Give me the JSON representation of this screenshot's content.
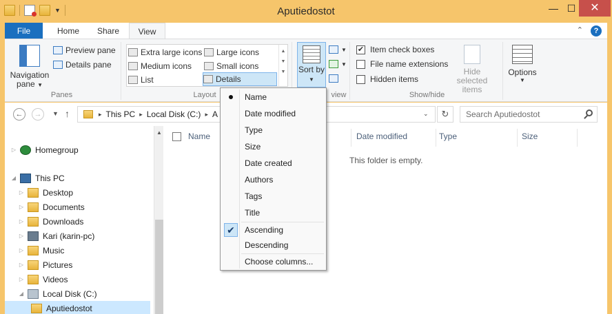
{
  "window": {
    "title": "Aputiedostot"
  },
  "ribbon_tabs": [
    "File",
    "Home",
    "Share",
    "View"
  ],
  "ribbon": {
    "navigation_pane": "Navigation pane",
    "preview_pane": "Preview pane",
    "details_pane": "Details pane",
    "panes_label": "Panes",
    "layout_items": [
      "Extra large icons",
      "Large icons",
      "Medium icons",
      "Small icons",
      "List",
      "Details"
    ],
    "layout_label": "Layout",
    "sort_by": "Sort by",
    "current_view_label_partial": "view",
    "item_check_boxes": "Item check boxes",
    "file_name_extensions": "File name extensions",
    "hidden_items": "Hidden items",
    "hide_selected_items": "Hide selected items",
    "show_hide_label": "Show/hide",
    "options": "Options"
  },
  "address": {
    "crumbs": [
      "This PC",
      "Local Disk (C:)",
      "A"
    ],
    "search_placeholder": "Search Aputiedostot"
  },
  "nav_tree": [
    {
      "label": "Homegroup",
      "icon": "homegroup-icon"
    },
    {
      "label": "This PC",
      "icon": "computer-icon"
    },
    {
      "label": "Desktop",
      "icon": "folder-icon"
    },
    {
      "label": "Documents",
      "icon": "folder-icon"
    },
    {
      "label": "Downloads",
      "icon": "folder-icon"
    },
    {
      "label": "Kari (karin-pc)",
      "icon": "user-computer-icon"
    },
    {
      "label": "Music",
      "icon": "music-folder-icon"
    },
    {
      "label": "Pictures",
      "icon": "folder-icon"
    },
    {
      "label": "Videos",
      "icon": "folder-icon"
    },
    {
      "label": "Local Disk (C:)",
      "icon": "disk-icon"
    },
    {
      "label": "Aputiedostot",
      "icon": "folder-icon"
    }
  ],
  "columns": [
    "Name",
    "Date modified",
    "Type",
    "Size"
  ],
  "empty_message": "This folder is empty.",
  "sort_menu": {
    "fields": [
      "Name",
      "Date modified",
      "Type",
      "Size",
      "Date created",
      "Authors",
      "Tags",
      "Title"
    ],
    "selected_field": "Name",
    "order": [
      "Ascending",
      "Descending"
    ],
    "selected_order": "Ascending",
    "choose_columns": "Choose columns..."
  },
  "check_states": {
    "item_check_boxes": true,
    "file_name_extensions": false,
    "hidden_items": false
  }
}
